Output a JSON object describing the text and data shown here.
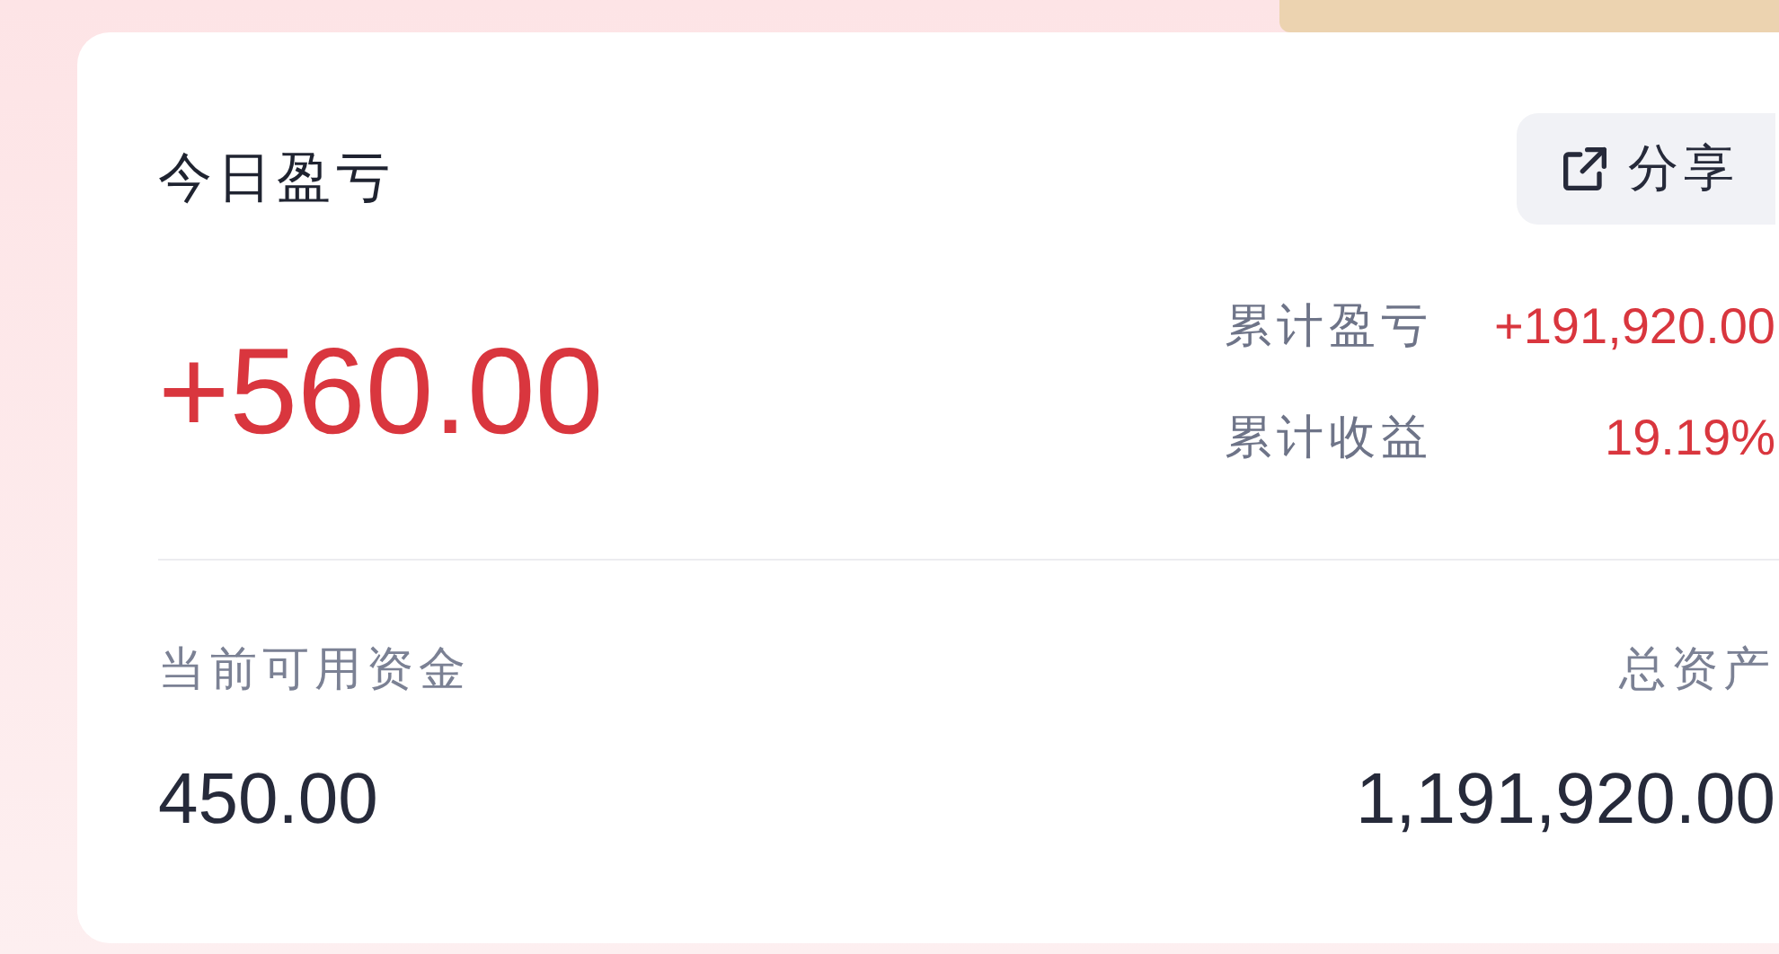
{
  "card": {
    "title": "今日盈亏",
    "share_button": {
      "label": "分享"
    },
    "today_pnl": "+560.00",
    "stats": [
      {
        "label": "累计盈亏",
        "value": "+191,920.00"
      },
      {
        "label": "累计收益",
        "value": "19.19%"
      }
    ],
    "footer": [
      {
        "label": "当前可用资金",
        "value": "450.00"
      },
      {
        "label": "总资产",
        "value": "1,191,920.00"
      }
    ]
  }
}
